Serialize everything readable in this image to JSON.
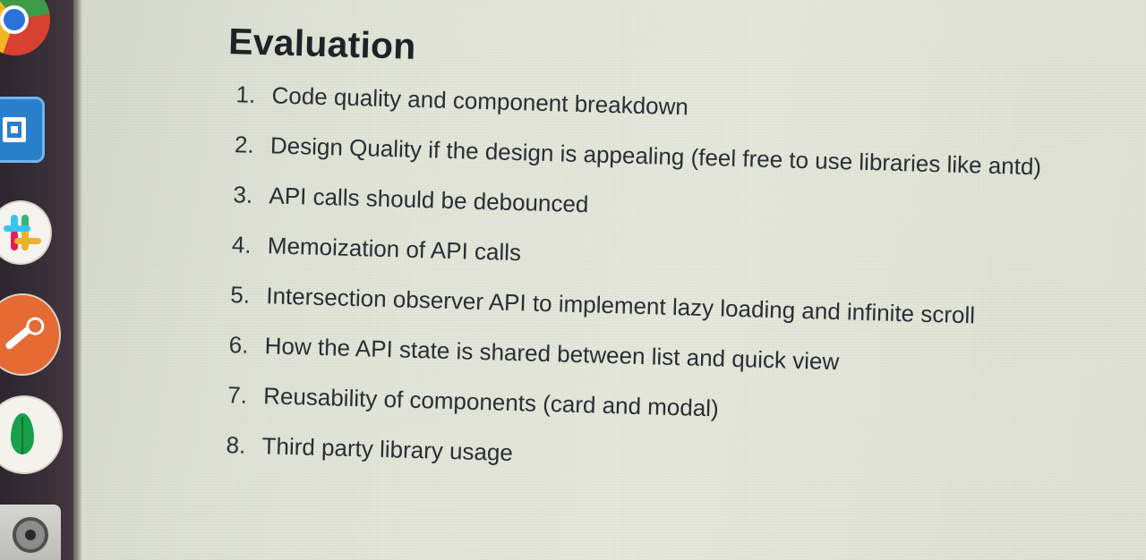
{
  "document": {
    "title": "Evaluation",
    "items": [
      {
        "number": "1.",
        "text": "Code quality and component breakdown"
      },
      {
        "number": "2.",
        "text": "Design Quality if the design is appealing (feel free to use libraries like antd)"
      },
      {
        "number": "3.",
        "text": "API calls should be debounced"
      },
      {
        "number": "4.",
        "text": "Memoization of API calls"
      },
      {
        "number": "5.",
        "text": "Intersection observer API to implement lazy loading and infinite scroll"
      },
      {
        "number": "6.",
        "text": "How the API state is shared between list and quick view"
      },
      {
        "number": "7.",
        "text": "Reusability of components (card and modal)"
      },
      {
        "number": "8.",
        "text": "Third party library usage"
      }
    ]
  },
  "dock": {
    "apps": [
      {
        "icon": "chrome-icon",
        "color": "#2b73d9"
      },
      {
        "icon": "code-editor-icon",
        "color": "#2a7fcb"
      },
      {
        "icon": "slack-icon",
        "color": "#e01e5a"
      },
      {
        "icon": "postman-icon",
        "color": "#e56a34"
      },
      {
        "icon": "mongodb-icon",
        "color": "#16a14a"
      },
      {
        "icon": "disk-icon",
        "color": "#505050"
      }
    ]
  }
}
